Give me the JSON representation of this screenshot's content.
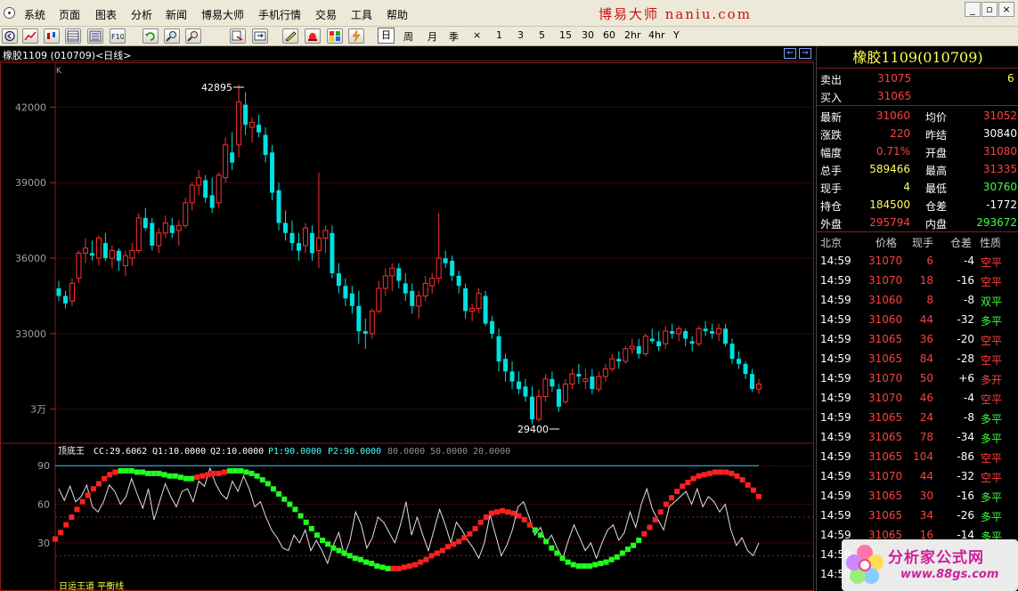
{
  "menu": {
    "items": [
      "系统",
      "页面",
      "图表",
      "分析",
      "新闻",
      "博易大师",
      "手机行情",
      "交易",
      "工具",
      "帮助"
    ],
    "brand": "博易大师 naniu.com"
  },
  "toolbar": {
    "periods": [
      "日",
      "周",
      "月",
      "季",
      "×",
      "1",
      "3",
      "5",
      "15",
      "30",
      "60",
      "2hr",
      "4hr",
      "Y"
    ],
    "selected_period": "日"
  },
  "chart": {
    "title": "橡胶1109 (010709)<日线>",
    "k_label": "K",
    "y_ticks": [
      "42000",
      "39000",
      "36000",
      "33000",
      "3万"
    ],
    "high_label": "42895",
    "low_label": "29400"
  },
  "indicator": {
    "header": {
      "name": "顶底王",
      "cc": "CC:29.6062",
      "q1": "Q1:10.0000",
      "q2": "Q2:10.0000",
      "p1": "P1:90.0000",
      "p2": "P2:90.0000",
      "lv1": "80.0000",
      "lv2": "50.0000",
      "lv3": "20.0000"
    },
    "y_ticks": [
      "90",
      "60",
      "30"
    ],
    "footer_text": "日运王道 平衡线"
  },
  "quote": {
    "title": "橡胶1109(010709)",
    "ask": {
      "label": "卖出",
      "price": "31075",
      "vol": "6"
    },
    "bid": {
      "label": "买入",
      "price": "31065"
    },
    "stats": [
      {
        "l1": "最新",
        "v1": "31060",
        "l2": "均价",
        "v2": "31052",
        "c1": "#ff4040",
        "c2": "#ff4040"
      },
      {
        "l1": "涨跌",
        "v1": "220",
        "l2": "昨结",
        "v2": "30840",
        "c1": "#ff4040",
        "c2": "#ffffff"
      },
      {
        "l1": "幅度",
        "v1": "0.71%",
        "l2": "开盘",
        "v2": "31080",
        "c1": "#ff4040",
        "c2": "#ff4040"
      },
      {
        "l1": "总手",
        "v1": "589466",
        "l2": "最高",
        "v2": "31335",
        "c1": "#ffff60",
        "c2": "#ff4040"
      },
      {
        "l1": "现手",
        "v1": "4",
        "l2": "最低",
        "v2": "30760",
        "c1": "#ffff60",
        "c2": "#40ff40"
      },
      {
        "l1": "持仓",
        "v1": "184500",
        "l2": "仓差",
        "v2": "-1772",
        "c1": "#ffff60",
        "c2": "#ffffff"
      },
      {
        "l1": "外盘",
        "v1": "295794",
        "l2": "内盘",
        "v2": "293672",
        "c1": "#ff4040",
        "c2": "#40ff40"
      }
    ],
    "tick_header": [
      "北京",
      "价格",
      "现手",
      "仓差",
      "性质"
    ],
    "ticks": [
      {
        "t": "14:59",
        "p": "31070",
        "v": "6",
        "d": "-4",
        "n": "空平",
        "nc": "#ff4040"
      },
      {
        "t": "14:59",
        "p": "31070",
        "v": "18",
        "d": "-16",
        "n": "空平",
        "nc": "#ff4040"
      },
      {
        "t": "14:59",
        "p": "31060",
        "v": "8",
        "d": "-8",
        "n": "双平",
        "nc": "#40ff40"
      },
      {
        "t": "14:59",
        "p": "31060",
        "v": "44",
        "d": "-32",
        "n": "多平",
        "nc": "#40ff40"
      },
      {
        "t": "14:59",
        "p": "31065",
        "v": "36",
        "d": "-20",
        "n": "空平",
        "nc": "#ff4040"
      },
      {
        "t": "14:59",
        "p": "31065",
        "v": "84",
        "d": "-28",
        "n": "空平",
        "nc": "#ff4040"
      },
      {
        "t": "14:59",
        "p": "31070",
        "v": "50",
        "d": "+6",
        "n": "多开",
        "nc": "#ff4040"
      },
      {
        "t": "14:59",
        "p": "31070",
        "v": "46",
        "d": "-4",
        "n": "空平",
        "nc": "#ff4040"
      },
      {
        "t": "14:59",
        "p": "31065",
        "v": "24",
        "d": "-8",
        "n": "多平",
        "nc": "#40ff40"
      },
      {
        "t": "14:59",
        "p": "31065",
        "v": "78",
        "d": "-34",
        "n": "多平",
        "nc": "#40ff40"
      },
      {
        "t": "14:59",
        "p": "31065",
        "v": "104",
        "d": "-86",
        "n": "空平",
        "nc": "#ff4040"
      },
      {
        "t": "14:59",
        "p": "31070",
        "v": "44",
        "d": "-32",
        "n": "空平",
        "nc": "#ff4040"
      },
      {
        "t": "14:59",
        "p": "31065",
        "v": "30",
        "d": "-16",
        "n": "多平",
        "nc": "#40ff40"
      },
      {
        "t": "14:59",
        "p": "31065",
        "v": "34",
        "d": "-26",
        "n": "多平",
        "nc": "#40ff40"
      },
      {
        "t": "14:59",
        "p": "31065",
        "v": "16",
        "d": "-14",
        "n": "多平",
        "nc": "#40ff40"
      },
      {
        "t": "14:59",
        "p": "",
        "v": "",
        "d": "",
        "n": "",
        "nc": "#40ff40"
      },
      {
        "t": "14:59",
        "p": "",
        "v": "",
        "d": "",
        "n": "",
        "nc": "#40ff40"
      }
    ]
  },
  "watermark": {
    "title": "分析家公式网",
    "url": "www.88gs.com"
  },
  "colors": {
    "up": "#ff3030",
    "down": "#00e0e0",
    "grid": "#8a1a1a",
    "bg": "#000000"
  },
  "chart_data": {
    "type": "candlestick",
    "ylim": [
      29000,
      43500
    ],
    "candles": [
      [
        34800,
        35100,
        34300,
        34500
      ],
      [
        34500,
        34700,
        34000,
        34200
      ],
      [
        34300,
        35200,
        34100,
        35000
      ],
      [
        35200,
        36300,
        35000,
        36200
      ],
      [
        36200,
        36800,
        35800,
        36400
      ],
      [
        36200,
        36700,
        35900,
        36100
      ],
      [
        36000,
        36900,
        35700,
        36800
      ],
      [
        36600,
        37000,
        35900,
        36000
      ],
      [
        36000,
        36500,
        35600,
        36300
      ],
      [
        36300,
        36400,
        35500,
        35900
      ],
      [
        35700,
        36300,
        35300,
        36100
      ],
      [
        36000,
        36600,
        35700,
        36300
      ],
      [
        36300,
        37800,
        36200,
        37600
      ],
      [
        37600,
        38000,
        37100,
        37200
      ],
      [
        37400,
        37600,
        36300,
        36500
      ],
      [
        36500,
        37200,
        36200,
        37000
      ],
      [
        37000,
        37700,
        36800,
        37400
      ],
      [
        37300,
        37600,
        36800,
        37000
      ],
      [
        37100,
        37500,
        36500,
        37300
      ],
      [
        37300,
        38400,
        37200,
        38200
      ],
      [
        38200,
        39000,
        37900,
        38900
      ],
      [
        38900,
        39500,
        38500,
        39200
      ],
      [
        39100,
        39300,
        38200,
        38400
      ],
      [
        38500,
        39200,
        37800,
        38000
      ],
      [
        38200,
        39400,
        38000,
        39300
      ],
      [
        39200,
        40800,
        39000,
        40500
      ],
      [
        40200,
        41000,
        39500,
        39800
      ],
      [
        40500,
        42895,
        40000,
        42200
      ],
      [
        42100,
        42600,
        40900,
        41300
      ],
      [
        41200,
        41600,
        40600,
        41400
      ],
      [
        41300,
        41700,
        40800,
        41000
      ],
      [
        40900,
        41200,
        39800,
        40100
      ],
      [
        40200,
        40500,
        38300,
        38600
      ],
      [
        38700,
        39000,
        37100,
        37400
      ],
      [
        37400,
        37900,
        36700,
        37000
      ],
      [
        37000,
        37500,
        36300,
        36600
      ],
      [
        36600,
        37000,
        35900,
        36300
      ],
      [
        36500,
        37400,
        36200,
        37200
      ],
      [
        37000,
        37300,
        35900,
        36200
      ],
      [
        36300,
        39400,
        35600,
        36800
      ],
      [
        36800,
        37300,
        36200,
        37100
      ],
      [
        37000,
        37300,
        35200,
        35400
      ],
      [
        35400,
        35800,
        34600,
        34900
      ],
      [
        34900,
        35200,
        34100,
        34400
      ],
      [
        34600,
        34900,
        33800,
        34100
      ],
      [
        34100,
        34700,
        32600,
        33100
      ],
      [
        33100,
        33600,
        32400,
        33000
      ],
      [
        33000,
        34000,
        32800,
        33900
      ],
      [
        33900,
        35100,
        33800,
        34800
      ],
      [
        34800,
        35600,
        34500,
        35300
      ],
      [
        35300,
        35800,
        34700,
        35600
      ],
      [
        35600,
        35800,
        34800,
        35100
      ],
      [
        35000,
        35400,
        34300,
        34600
      ],
      [
        34700,
        35000,
        33800,
        34100
      ],
      [
        34100,
        34700,
        33600,
        34500
      ],
      [
        34500,
        35300,
        34300,
        35000
      ],
      [
        34900,
        35400,
        34600,
        35200
      ],
      [
        35200,
        37800,
        35000,
        36000
      ],
      [
        36000,
        36300,
        35600,
        35800
      ],
      [
        35900,
        36100,
        35100,
        35300
      ],
      [
        35300,
        35500,
        34600,
        34900
      ],
      [
        34800,
        35000,
        33600,
        33900
      ],
      [
        33900,
        34200,
        33500,
        34000
      ],
      [
        34000,
        34800,
        33800,
        34600
      ],
      [
        34500,
        34700,
        33300,
        33400
      ],
      [
        33500,
        33700,
        32800,
        33000
      ],
      [
        32900,
        33200,
        31500,
        31900
      ],
      [
        32000,
        32200,
        31100,
        31500
      ],
      [
        31500,
        31900,
        30800,
        31100
      ],
      [
        31100,
        31500,
        30600,
        30800
      ],
      [
        30900,
        31200,
        30300,
        30500
      ],
      [
        30500,
        30900,
        29400,
        29600
      ],
      [
        29600,
        30800,
        29500,
        30500
      ],
      [
        30500,
        31400,
        30300,
        31200
      ],
      [
        31200,
        31500,
        30700,
        30900
      ],
      [
        30800,
        31000,
        29900,
        30100
      ],
      [
        30300,
        31200,
        30200,
        31000
      ],
      [
        31000,
        31600,
        30800,
        31400
      ],
      [
        31400,
        31800,
        31000,
        31300
      ],
      [
        31100,
        31600,
        30800,
        31200
      ],
      [
        31300,
        31600,
        30600,
        30800
      ],
      [
        30800,
        31500,
        30700,
        31300
      ],
      [
        31300,
        31800,
        31100,
        31600
      ],
      [
        31600,
        32200,
        31500,
        32000
      ],
      [
        32000,
        32300,
        31600,
        31900
      ],
      [
        31900,
        32500,
        31800,
        32400
      ],
      [
        32400,
        32800,
        32200,
        32500
      ],
      [
        32500,
        32800,
        32000,
        32200
      ],
      [
        32200,
        33000,
        32100,
        32900
      ],
      [
        32800,
        33200,
        32600,
        32700
      ],
      [
        32700,
        33100,
        32300,
        32500
      ],
      [
        32600,
        33300,
        32400,
        33100
      ],
      [
        33100,
        33400,
        32800,
        33000
      ],
      [
        33000,
        33300,
        32700,
        33200
      ],
      [
        33100,
        33200,
        32500,
        32800
      ],
      [
        32700,
        32900,
        32300,
        32600
      ],
      [
        32600,
        33300,
        32500,
        33200
      ],
      [
        33200,
        33500,
        32900,
        33100
      ],
      [
        33100,
        33400,
        32800,
        33000
      ],
      [
        33000,
        33400,
        32700,
        33200
      ],
      [
        33200,
        33400,
        32500,
        32600
      ],
      [
        32600,
        32800,
        31800,
        32000
      ],
      [
        32000,
        32300,
        31600,
        31800
      ],
      [
        31800,
        31900,
        31200,
        31400
      ],
      [
        31400,
        31600,
        30700,
        30800
      ],
      [
        30800,
        31200,
        30600,
        31000
      ]
    ],
    "indicator": {
      "ylim": [
        5,
        95
      ],
      "dots": [
        33,
        38,
        44,
        50,
        56,
        62,
        67,
        72,
        76,
        80,
        83,
        85,
        86,
        86,
        86,
        85,
        85,
        84,
        84,
        84,
        83,
        82,
        82,
        81,
        80,
        80,
        81,
        82,
        83,
        84,
        84,
        85,
        86,
        86,
        86,
        85,
        84,
        82,
        79,
        76,
        72,
        68,
        64,
        60,
        56,
        51,
        46,
        41,
        36,
        32,
        29,
        26,
        24,
        22,
        20,
        18,
        17,
        15,
        14,
        12,
        11,
        10,
        10,
        10,
        11,
        12,
        13,
        15,
        17,
        20,
        22,
        24,
        27,
        29,
        31,
        34,
        37,
        41,
        46,
        50,
        53,
        54,
        55,
        54,
        53,
        51,
        48,
        44,
        40,
        36,
        31,
        26,
        22,
        18,
        15,
        13,
        12,
        12,
        12,
        13,
        14,
        15,
        17,
        19,
        22,
        25,
        28,
        32,
        37,
        42,
        48,
        54,
        60,
        65,
        70,
        74,
        77,
        80,
        82,
        83,
        84,
        85,
        85,
        85,
        84,
        82,
        79,
        75,
        71,
        66
      ],
      "dot_colors": "RRRRRRRRRRRRGGGGGGGGGGGGGGRRRRRRGGGGGGGGGGGGGGGGGGGGGGGGGGGGGGRRRRRRRRRRRRRRRRRRRRRRRRRRGGGGGGGGGGGGGGGGGGGGRRRRRRRRRRRRRRRRRRRRRRRRRRRRRRRRRRGGGGGGGG",
      "white_line": [
        72,
        63,
        74,
        62,
        66,
        75,
        58,
        54,
        62,
        75,
        70,
        60,
        66,
        80,
        68,
        57,
        72,
        48,
        62,
        76,
        66,
        58,
        70,
        72,
        62,
        78,
        74,
        88,
        76,
        68,
        64,
        78,
        70,
        82,
        72,
        58,
        62,
        50,
        40,
        34,
        26,
        24,
        36,
        30,
        40,
        24,
        32,
        24,
        14,
        28,
        38,
        20,
        32,
        54,
        44,
        26,
        34,
        50,
        46,
        38,
        30,
        44,
        62,
        36,
        50,
        36,
        24,
        40,
        56,
        44,
        30,
        46,
        40,
        32,
        26,
        18,
        30,
        52,
        36,
        20,
        28,
        40,
        58,
        62,
        50,
        36,
        42,
        30,
        36,
        26,
        18,
        32,
        44,
        34,
        24,
        30,
        18,
        30,
        40,
        44,
        32,
        38,
        54,
        42,
        60,
        72,
        56,
        48,
        40,
        58,
        62,
        66,
        70,
        60,
        72,
        58,
        66,
        62,
        54,
        60,
        40,
        28,
        34,
        24,
        20,
        30
      ]
    }
  }
}
